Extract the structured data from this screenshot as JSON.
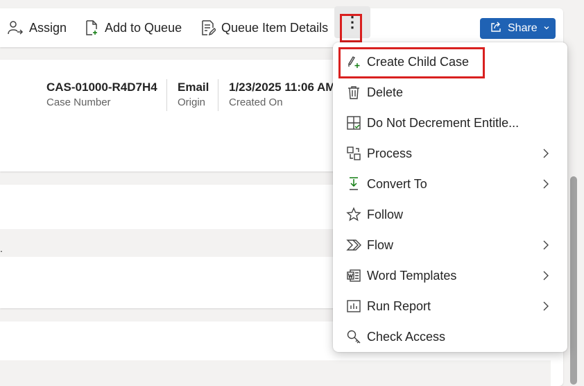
{
  "toolbar": {
    "assign_label": "Assign",
    "add_to_queue_label": "Add to Queue",
    "queue_item_details_label": "Queue Item Details",
    "more_glyph": "⋮",
    "share_label": "Share"
  },
  "header_fields": [
    {
      "value": "CAS-01000-R4D7H4",
      "label": "Case Number"
    },
    {
      "value": "Email",
      "label": "Origin"
    },
    {
      "value": "1/23/2025 11:06 AM",
      "label": "Created On"
    }
  ],
  "background_mark": ".",
  "menu": {
    "items": [
      {
        "label": "Create Child Case",
        "icon": "create-child-case-icon",
        "has_submenu": false
      },
      {
        "label": "Delete",
        "icon": "trash-icon",
        "has_submenu": false
      },
      {
        "label": "Do Not Decrement Entitle...",
        "icon": "grid-check-icon",
        "has_submenu": false
      },
      {
        "label": "Process",
        "icon": "process-icon",
        "has_submenu": true
      },
      {
        "label": "Convert To",
        "icon": "convert-icon",
        "has_submenu": true
      },
      {
        "label": "Follow",
        "icon": "star-icon",
        "has_submenu": false
      },
      {
        "label": "Flow",
        "icon": "flow-icon",
        "has_submenu": true
      },
      {
        "label": "Word Templates",
        "icon": "word-templates-icon",
        "has_submenu": true
      },
      {
        "label": "Run Report",
        "icon": "report-icon",
        "has_submenu": true
      },
      {
        "label": "Check Access",
        "icon": "check-access-icon",
        "has_submenu": false
      }
    ]
  },
  "colors": {
    "accent": "#1f62b4",
    "highlight": "#d9201f",
    "convert_icon_green": "#107c10"
  }
}
